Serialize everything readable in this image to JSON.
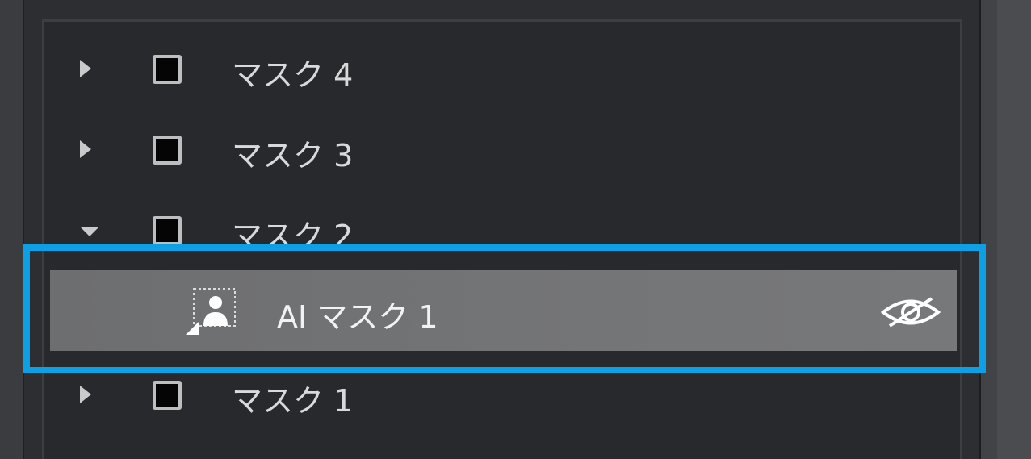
{
  "mask_list": {
    "items": [
      {
        "label": "マスク 4",
        "expanded": false
      },
      {
        "label": "マスク 3",
        "expanded": false
      },
      {
        "label": "マスク 2",
        "expanded": true
      },
      {
        "label": "マスク 1",
        "expanded": false
      }
    ],
    "sub_item": {
      "label": "AI マスク 1",
      "icon": "ai-person-mask-icon",
      "visibility_icon": "eye-hidden-icon",
      "selected": true
    }
  },
  "colors": {
    "highlight_frame": "#0ea0e4",
    "selected_row_bg": "#727375",
    "panel_bg": "#27292c"
  }
}
